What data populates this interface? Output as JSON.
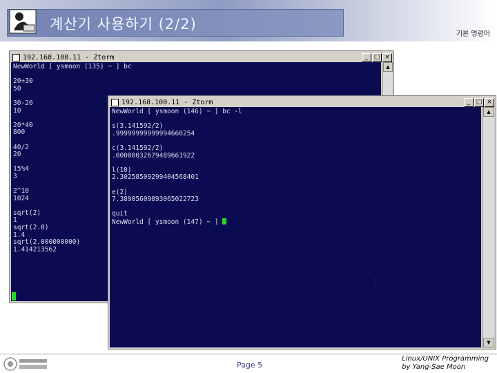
{
  "slide": {
    "title": "계산기 사용하기 (2/2)",
    "subtitle": "기본 명령어",
    "page_label": "Page 5",
    "course_line1": "Linux/UNIX Programming",
    "course_line2": "by Yang-Sae Moon"
  },
  "window_back": {
    "title": "192.168.100.11 - Ztorm",
    "lines": [
      "NewWorld [ ysmoon (135) ~ ] bc",
      "",
      "20+30",
      "50",
      "",
      "30-20",
      "10",
      "",
      "20*40",
      "800",
      "",
      "40/2",
      "20",
      "",
      "15%4",
      "3",
      "",
      "2^10",
      "1024",
      "",
      "sqrt(2)",
      "1",
      "sqrt(2.0)",
      "1.4",
      "sqrt(2.000000000)",
      "1.414213562"
    ]
  },
  "window_front": {
    "title": "192.168.100.11 - Ztorm",
    "lines": [
      "NewWorld [ ysmoon (146) ~ ] bc -l",
      "",
      "s(3.141592/2)",
      ".99999999999994660254",
      "",
      "c(3.141592/2)",
      ".00000032679489661922",
      "",
      "l(10)",
      "2.30258509299404568401",
      "",
      "e(2)",
      "7.38905609893065022723",
      "",
      "quit",
      "NewWorld [ ysmoon (147) ~ ] "
    ]
  },
  "window_buttons": {
    "minimize": "_",
    "maximize": "□",
    "close": "×"
  }
}
